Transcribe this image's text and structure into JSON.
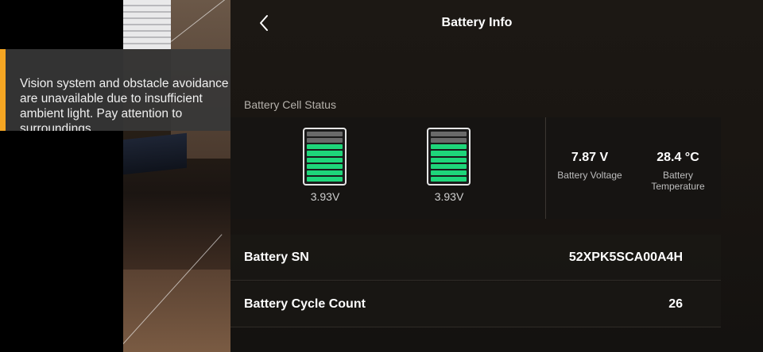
{
  "header": {
    "title": "Battery Info",
    "back_icon": "chevron-left-icon"
  },
  "warning": {
    "message": "Vision system and obstacle avoidance\nare unavailable due to insufficient\nambient light. Pay attention to\nsurroundings",
    "accent_color": "#f5a623"
  },
  "cell_status": {
    "label": "Battery Cell Status",
    "cells": [
      {
        "voltage": "3.93V",
        "filled_segments": 6,
        "total_segments": 8
      },
      {
        "voltage": "3.93V",
        "filled_segments": 6,
        "total_segments": 8
      }
    ],
    "fill_color": "#1ed67a"
  },
  "stats": {
    "voltage": {
      "value": "7.87 V",
      "label": "Battery Voltage"
    },
    "temperature": {
      "value": "28.4 °C",
      "label": "Battery\nTemperature"
    }
  },
  "details": [
    {
      "key": "Battery SN",
      "value": "52XPK5SCA00A4H"
    },
    {
      "key": "Battery Cycle Count",
      "value": "26"
    }
  ]
}
